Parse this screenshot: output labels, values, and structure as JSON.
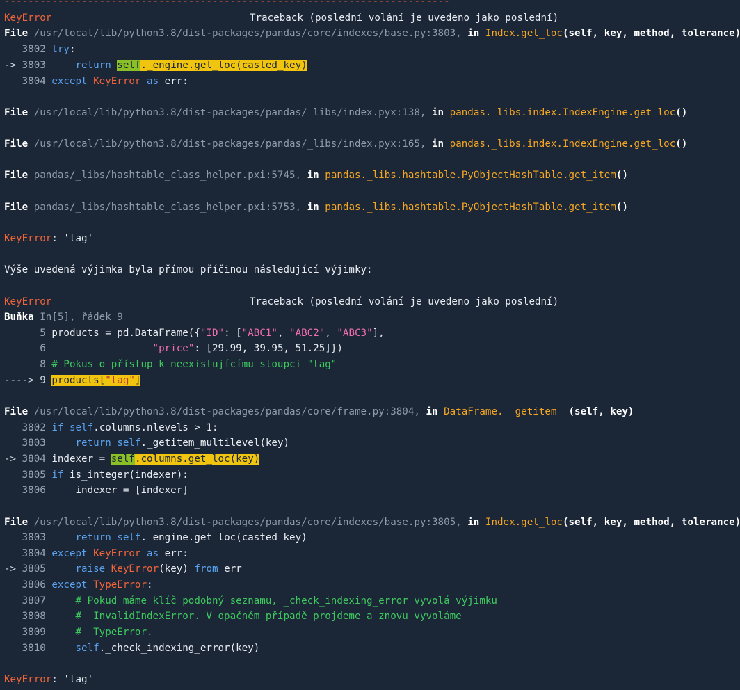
{
  "separator": "---------------------------------------------------------------------------",
  "error_name": "KeyError",
  "traceback_label": "Traceback (poslední volání je uvedeno jako poslední)",
  "file_label": "File",
  "in_label": "in",
  "block1": {
    "frame1": {
      "path": "/usr/local/lib/python3.8/dist-packages/pandas/core/indexes/base.py:3803,",
      "func": "Index.get_loc",
      "args": "(self, key, method, tolerance)",
      "lines": [
        {
          "arrow": "   ",
          "num": "3802",
          "code": "try:"
        },
        {
          "arrow": "-> ",
          "num": "3803",
          "code": "    return self._engine.get_loc(casted_key)"
        },
        {
          "arrow": "   ",
          "num": "3804",
          "code": "except KeyError as err:"
        }
      ]
    },
    "frame2": {
      "path": "/usr/local/lib/python3.8/dist-packages/pandas/_libs/index.pyx:138,",
      "func": "pandas._libs.index.IndexEngine.get_loc",
      "args": "()"
    },
    "frame3": {
      "path": "/usr/local/lib/python3.8/dist-packages/pandas/_libs/index.pyx:165,",
      "func": "pandas._libs.index.IndexEngine.get_loc",
      "args": "()"
    },
    "frame4": {
      "path": "pandas/_libs/hashtable_class_helper.pxi:5745,",
      "func": "pandas._libs.hashtable.PyObjectHashTable.get_item",
      "args": "()"
    },
    "frame5": {
      "path": "pandas/_libs/hashtable_class_helper.pxi:5753,",
      "func": "pandas._libs.hashtable.PyObjectHashTable.get_item",
      "args": "()"
    },
    "error_msg": ": 'tag'"
  },
  "cause_text": "Výše uvedená výjimka byla přímou příčinou následující výjimky:",
  "block2": {
    "cell_label": "Buňka",
    "cell_ref": "In[5], řádek 9",
    "cell_lines": {
      "l5_num": "5",
      "l6_num": "6",
      "l7_num": "8",
      "l7_comment": "# Pokus o přístup k neexistujícímu sloupci \"tag\"",
      "l8_arrow": "----> 9",
      "l8_code": "products[\"tag\"]",
      "s_id": "\"ID\"",
      "s_abc1": "\"ABC1\"",
      "s_abc2": "\"ABC2\"",
      "s_abc3": "\"ABC3\"",
      "s_price": "\"price\"",
      "n1": "29.99",
      "n2": "39.95",
      "n3": "51.25"
    },
    "frame1": {
      "path": "/usr/local/lib/python3.8/dist-packages/pandas/core/frame.py:3804,",
      "func": "DataFrame.__getitem__",
      "args": "(self, key)"
    },
    "frame2": {
      "path": "/usr/local/lib/python3.8/dist-packages/pandas/core/indexes/base.py:3805,",
      "func": "Index.get_loc",
      "args": "(self, key, method, tolerance)"
    },
    "error_msg": ": 'tag'"
  }
}
